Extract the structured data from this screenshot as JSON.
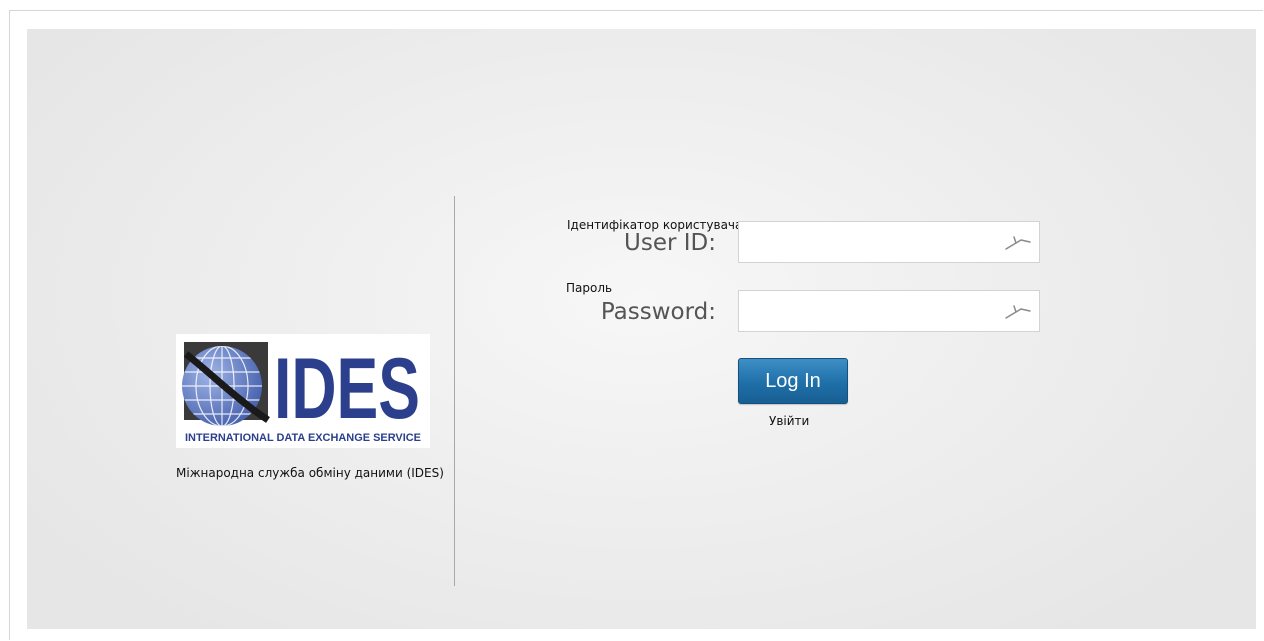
{
  "logo": {
    "wordmark": "IDES",
    "subtitle": "INTERNATIONAL DATA EXCHANGE SERVICE",
    "caption": "Міжнародна служба обміну даними (IDES)"
  },
  "form": {
    "user_id": {
      "translation": "Ідентифікатор користувача",
      "label": "User ID:",
      "value": "",
      "icon": "key-icon"
    },
    "password": {
      "translation": "Пароль",
      "label": "Password:",
      "value": "",
      "icon": "key-icon"
    },
    "login_button": {
      "label": "Log In",
      "translation": "Увійти"
    }
  },
  "colors": {
    "brand_navy": "#2b3f8c",
    "button_blue": "#1f6fa8",
    "background": "#efefef"
  }
}
